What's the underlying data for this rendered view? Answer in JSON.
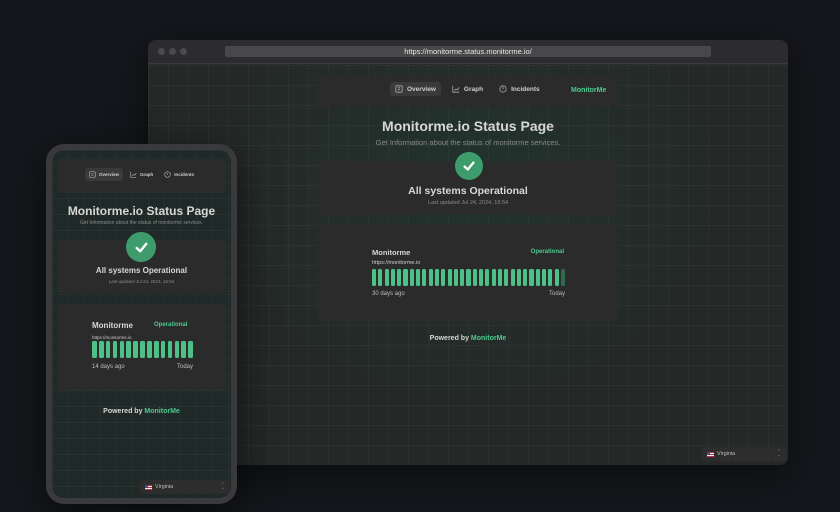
{
  "browser": {
    "url": "https://monitorme.status.monitorme.io/"
  },
  "nav": {
    "items": [
      {
        "label": "Overview",
        "icon": "overview-icon",
        "active": true
      },
      {
        "label": "Graph",
        "icon": "graph-icon",
        "active": false
      },
      {
        "label": "Incidents",
        "icon": "clock-icon",
        "active": false
      }
    ],
    "brand": "MonitorMe"
  },
  "header": {
    "title": "Monitorme.io Status Page",
    "subtitle": "Get Information about the status of monitorme services."
  },
  "status": {
    "icon": "check-icon",
    "title": "All systems Operational",
    "last_updated": "Last updated Jul 24, 2024, 16:54"
  },
  "monitor_desktop": {
    "name": "Monitorme",
    "url": "https://monitorme.io",
    "status": "Operational",
    "range_start": "30 days ago",
    "range_end": "Today",
    "days_up": 30,
    "days_no_data": 1
  },
  "monitor_mobile": {
    "name": "Monitorme",
    "url": "https://monitorme.io",
    "status": "Operational",
    "range_start": "14 days ago",
    "range_end": "Today",
    "days_up": 15,
    "days_no_data": 0
  },
  "footer": {
    "powered_prefix": "Powered by",
    "powered_brand": "MonitorMe"
  },
  "region_selector": {
    "flag": "us-flag-icon",
    "value": "Virginia"
  },
  "colors": {
    "accent": "#4ec98f",
    "check": "#3e9c6c",
    "bar_up": "#4fbf88",
    "bar_no_data": "#2f6a4e"
  }
}
